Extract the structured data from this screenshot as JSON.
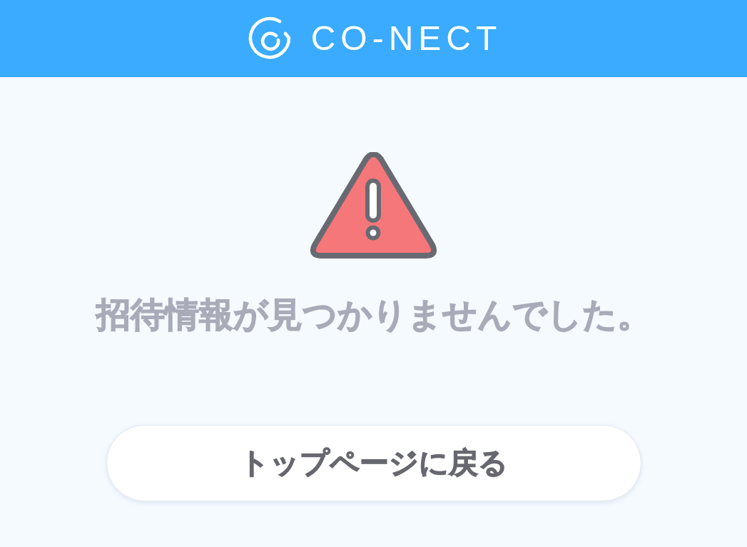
{
  "header": {
    "logo_text": "CO-NECT"
  },
  "message": "招待情報が見つかりませんでした。",
  "button": {
    "label": "トップページに戻る"
  }
}
